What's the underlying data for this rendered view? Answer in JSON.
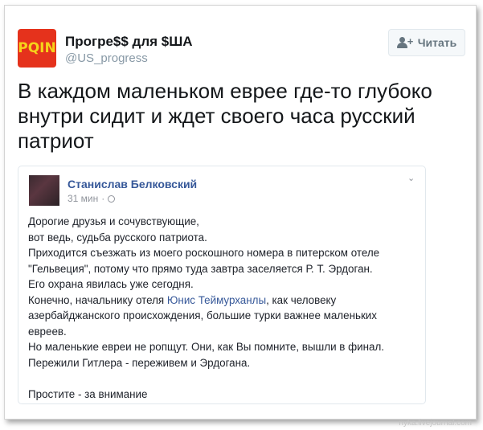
{
  "account": {
    "avatar_text": "PQIN",
    "name": "Прогре$$ для $ША",
    "handle": "@US_progress"
  },
  "follow": {
    "label": "Читать"
  },
  "tweet_text": "В каждом маленьком еврее где-то глубоко внутри сидит и ждет своего часа русский патриот",
  "quoted_post": {
    "author": "Станислав Белковский",
    "time": "31 мин",
    "lines": [
      "Дорогие друзья и сочувствующие,",
      "вот ведь, судьба русского патриота.",
      "Приходится съезжать из моего роскошного номера в питерском отеле",
      "\"Гельвеция\", потому что прямо туда завтра заселяется Р. Т. Эрдоган.",
      "Его охрана явилась уже сегодня.",
      "Конечно, начальнику отеля ",
      "Юнис Теймурханлы",
      ", как человеку",
      "азербайджанского происхождения, большие турки важнее маленьких",
      "евреев.",
      "Но маленькие евреи не ропщут. Они, как Вы помните, вышли в финал.",
      "Пережили Гитлера - переживем и Эрдогана.",
      "Простите - за внимание"
    ]
  },
  "watermark": "nyka.livejournal.com",
  "colors": {
    "avatar_bg": "#e5321c",
    "avatar_text": "#f6d21a",
    "link": "#365899",
    "handle": "#8899a6"
  }
}
